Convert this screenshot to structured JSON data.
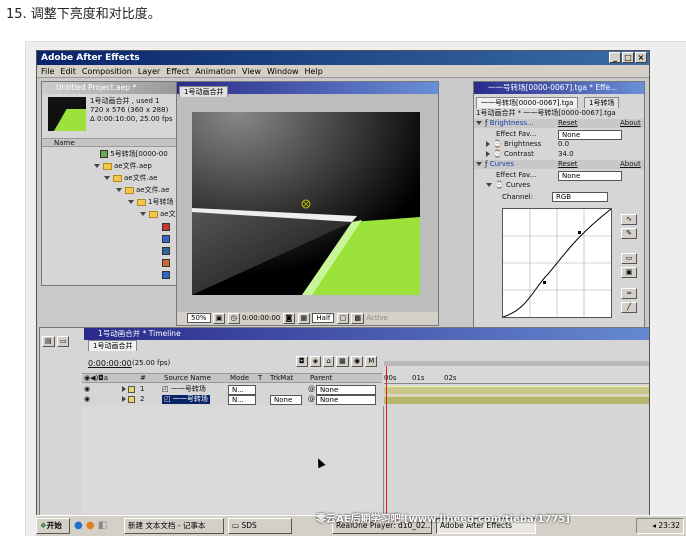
{
  "heading": "15. 调整下亮度和对比度。",
  "app": {
    "title": "Adobe After Effects"
  },
  "menu": [
    "File",
    "Edit",
    "Composition",
    "Layer",
    "Effect",
    "Animation",
    "View",
    "Window",
    "Help"
  ],
  "project": {
    "title": "Untitled Project.aep *",
    "info_lines": [
      "1号动画合并 , used 1",
      "720 x 576  (360 x 288)",
      "Δ 0:00:10:00, 25.00 fps"
    ],
    "column_name": "Name",
    "items": [
      "5号转场[0000-00",
      "ae文件.aep",
      "ae文件.ae",
      "ae文件.ae",
      "1号转场",
      "ae文"
    ]
  },
  "composition": {
    "title": "1号动画合并",
    "tab": "1号动画合并",
    "zoom": "50%",
    "timecode": "0:00:00:00",
    "resolution": "Half",
    "active_label": "Active"
  },
  "effects": {
    "title": "一一号转场[0000-0067].tga * Effe...",
    "tab1": "一一号转场[0000-0067].tga",
    "tab2": "1号转场",
    "path": "1号动画合并 * 一一号转场[0000-0067].tga",
    "brightness_contrast": {
      "name": "Brightness...",
      "reset": "Reset",
      "about": "About"
    },
    "effect_favorites": "Effect Fav...",
    "none": "None",
    "brightness_label": "Brightness",
    "brightness_value": "0.0",
    "contrast_label": "Contrast",
    "contrast_value": "34.0",
    "curves": {
      "name": "Curves",
      "reset": "Reset",
      "about": "About",
      "sub": "Curves",
      "channel_label": "Channel:",
      "channel_value": "RGB"
    }
  },
  "timeline": {
    "title": "1号动画合并 * Timeline",
    "tab": "1号动画合并",
    "timecode": "0:00:00:00",
    "fps": "(25.00 fps)",
    "columns": {
      "num": "#",
      "source": "Source Name",
      "mode": "Mode",
      "t": "T",
      "trkmat": "TrkMat",
      "parent": "Parent"
    },
    "ruler": [
      "00s",
      "01s",
      "02s"
    ],
    "layers": [
      {
        "num": "1",
        "name": "一一号转场",
        "mode": "N...",
        "trkmat": "",
        "parent": "None"
      },
      {
        "num": "2",
        "name": "一一号转场",
        "mode": "N...",
        "trkmat": "None",
        "parent": "None"
      }
    ]
  },
  "taskbar": {
    "start": "开始",
    "items": [
      "新建 文本文档 - 记事本",
      "SDS",
      "RealOne Player: d10_02...",
      "Adobe After Effects"
    ],
    "clock": "23:32",
    "watermark": "零云AE后期学习吧 [www.lineeg.com/tieba/1775]"
  },
  "colors": {
    "green": "#9be33b",
    "titlebar": "#08246b",
    "panel": "#d6d6d6"
  }
}
